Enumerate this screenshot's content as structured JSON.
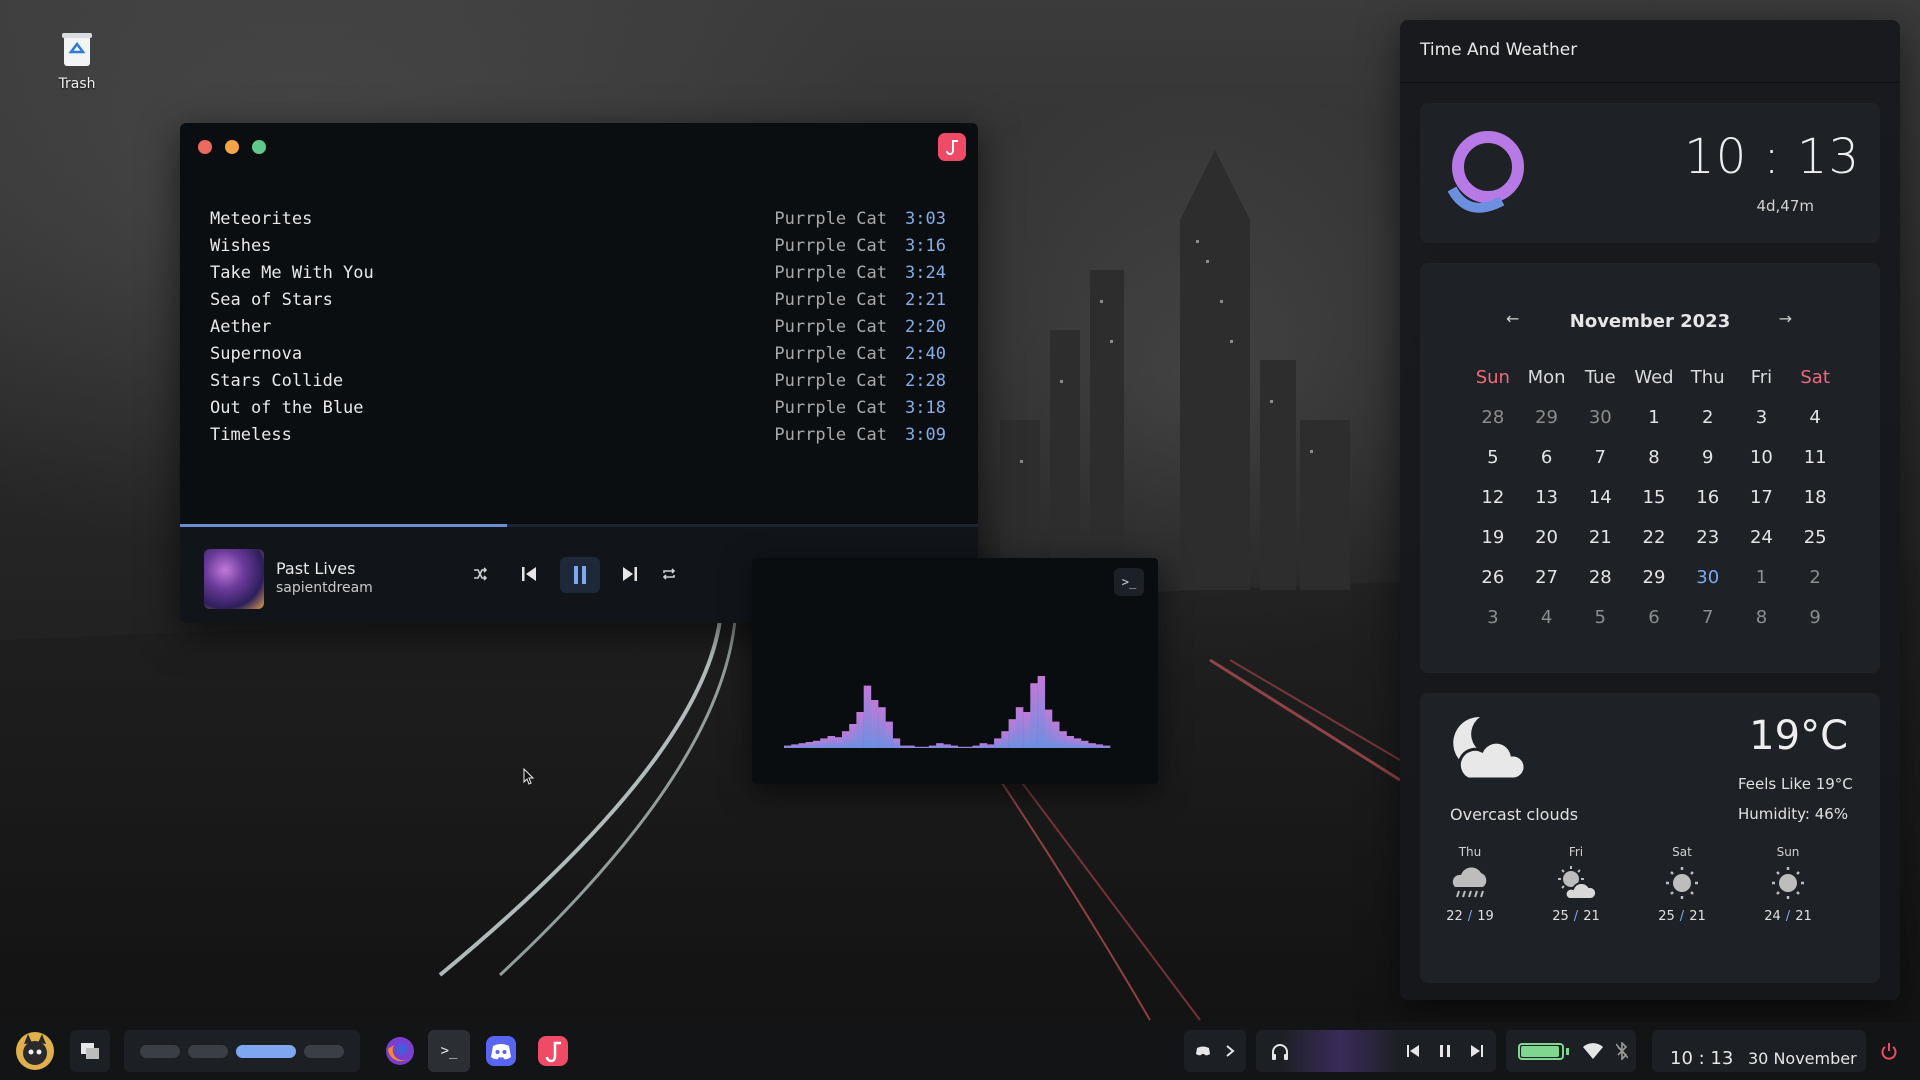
{
  "desktop": {
    "trash_label": "Trash"
  },
  "player": {
    "tracks": [
      {
        "name": "Meteorites",
        "artist": "Purrple Cat",
        "duration": "3:03"
      },
      {
        "name": "Wishes",
        "artist": "Purrple Cat",
        "duration": "3:16"
      },
      {
        "name": "Take Me With You",
        "artist": "Purrple Cat",
        "duration": "3:24"
      },
      {
        "name": "Sea of Stars",
        "artist": "Purrple Cat",
        "duration": "2:21"
      },
      {
        "name": "Aether",
        "artist": "Purrple Cat",
        "duration": "2:20"
      },
      {
        "name": "Supernova",
        "artist": "Purrple Cat",
        "duration": "2:40"
      },
      {
        "name": "Stars Collide",
        "artist": "Purrple Cat",
        "duration": "2:28"
      },
      {
        "name": "Out of the Blue",
        "artist": "Purrple Cat",
        "duration": "3:18"
      },
      {
        "name": "Timeless",
        "artist": "Purrple Cat",
        "duration": "3:09"
      }
    ],
    "progress_fraction": 0.41,
    "now_playing": {
      "title": "Past Lives",
      "artist": "sapientdream"
    },
    "controls": [
      "shuffle-icon",
      "previous-icon",
      "pause-icon",
      "next-icon",
      "repeat-icon",
      "queue-icon",
      "visualizer-icon"
    ],
    "accent": "#6d8fcf"
  },
  "visualizer": {
    "terminal_label": ">_",
    "bars": [
      2,
      3,
      4,
      5,
      6,
      8,
      10,
      9,
      14,
      20,
      30,
      52,
      40,
      34,
      22,
      8,
      2,
      2,
      1,
      1,
      2,
      4,
      3,
      2,
      1,
      1,
      2,
      4,
      3,
      8,
      14,
      24,
      34,
      30,
      54,
      60,
      32,
      22,
      14,
      10,
      8,
      6,
      4,
      3,
      2
    ],
    "gradient": [
      "#6d8fe0",
      "#c07ad8"
    ]
  },
  "widgets": {
    "title": "Time And Weather",
    "clock": {
      "time": "10 : 13",
      "uptime": "4d,47m"
    },
    "calendar": {
      "month": "November 2023",
      "prev": "←",
      "next": "→",
      "weekdays": [
        "Sun",
        "Mon",
        "Tue",
        "Wed",
        "Thu",
        "Fri",
        "Sat"
      ],
      "weeks": [
        [
          {
            "d": "28",
            "m": true
          },
          {
            "d": "29",
            "m": true
          },
          {
            "d": "30",
            "m": true
          },
          {
            "d": "1"
          },
          {
            "d": "2"
          },
          {
            "d": "3"
          },
          {
            "d": "4"
          }
        ],
        [
          {
            "d": "5"
          },
          {
            "d": "6"
          },
          {
            "d": "7"
          },
          {
            "d": "8"
          },
          {
            "d": "9"
          },
          {
            "d": "10"
          },
          {
            "d": "11"
          }
        ],
        [
          {
            "d": "12"
          },
          {
            "d": "13"
          },
          {
            "d": "14"
          },
          {
            "d": "15"
          },
          {
            "d": "16"
          },
          {
            "d": "17"
          },
          {
            "d": "18"
          }
        ],
        [
          {
            "d": "19"
          },
          {
            "d": "20"
          },
          {
            "d": "21"
          },
          {
            "d": "22"
          },
          {
            "d": "23"
          },
          {
            "d": "24"
          },
          {
            "d": "25"
          }
        ],
        [
          {
            "d": "26"
          },
          {
            "d": "27"
          },
          {
            "d": "28"
          },
          {
            "d": "29"
          },
          {
            "d": "30",
            "t": true
          },
          {
            "d": "1",
            "m": true
          },
          {
            "d": "2",
            "m": true
          }
        ],
        [
          {
            "d": "3",
            "m": true
          },
          {
            "d": "4",
            "m": true
          },
          {
            "d": "5",
            "m": true
          },
          {
            "d": "6",
            "m": true
          },
          {
            "d": "7",
            "m": true
          },
          {
            "d": "8",
            "m": true
          },
          {
            "d": "9",
            "m": true
          }
        ]
      ]
    },
    "weather": {
      "temp": "19°C",
      "condition": "Overcast clouds",
      "feels_like": "Feels Like 19°C",
      "humidity": "Humidity: 46%",
      "forecast": [
        {
          "day": "Thu",
          "icon": "rain-cloud-icon",
          "high": "22",
          "low": "19"
        },
        {
          "day": "Fri",
          "icon": "sun-cloud-icon",
          "high": "25",
          "low": "21"
        },
        {
          "day": "Sat",
          "icon": "sun-icon",
          "high": "25",
          "low": "21"
        },
        {
          "day": "Sun",
          "icon": "sun-icon",
          "high": "24",
          "low": "21"
        }
      ]
    }
  },
  "taskbar": {
    "time": "10 : 13",
    "date": "30 November",
    "battery_fraction": 0.95,
    "apps": [
      "firefox-icon",
      "terminal-icon",
      "discord-icon",
      "music-app-icon"
    ],
    "colors": {
      "accent": "#7ea7ef",
      "battery": "#7fd68e",
      "danger": "#ef4b67"
    }
  }
}
